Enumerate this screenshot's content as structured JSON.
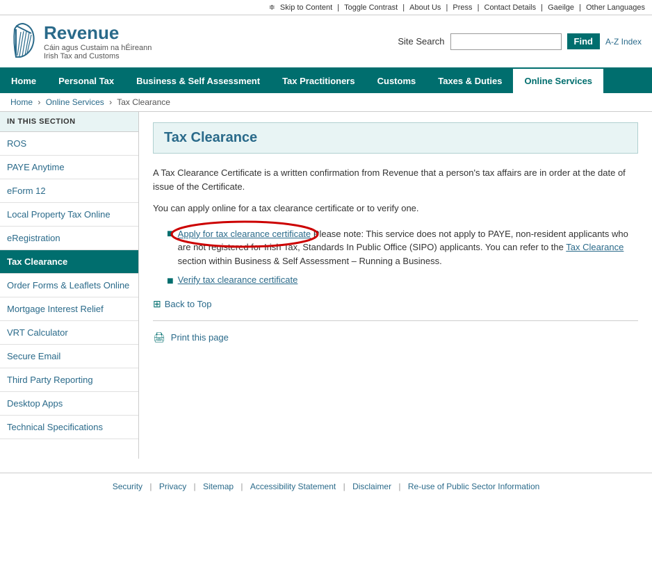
{
  "topbar": {
    "skip": "Skip to Content",
    "contrast": "Toggle Contrast",
    "about": "About Us",
    "press": "Press",
    "contact": "Contact Details",
    "gaeilge": "Gaeilge",
    "languages": "Other Languages"
  },
  "header": {
    "logo_line1": "Revenue",
    "logo_line2": "Cáin agus Custaim na hÉireann",
    "logo_line3": "Irish Tax and Customs",
    "search_label": "Site Search",
    "search_placeholder": "",
    "find_btn": "Find",
    "az": "A-Z Index"
  },
  "nav": {
    "items": [
      {
        "label": "Home",
        "active": false
      },
      {
        "label": "Personal Tax",
        "active": false
      },
      {
        "label": "Business & Self Assessment",
        "active": false
      },
      {
        "label": "Tax Practitioners",
        "active": false
      },
      {
        "label": "Customs",
        "active": false
      },
      {
        "label": "Taxes & Duties",
        "active": false
      },
      {
        "label": "Online Services",
        "active": true
      }
    ]
  },
  "breadcrumb": {
    "home": "Home",
    "online_services": "Online Services",
    "current": "Tax Clearance"
  },
  "sidebar": {
    "section_header": "IN THIS SECTION",
    "items": [
      {
        "label": "ROS",
        "active": false
      },
      {
        "label": "PAYE Anytime",
        "active": false
      },
      {
        "label": "eForm 12",
        "active": false
      },
      {
        "label": "Local Property Tax Online",
        "active": false
      },
      {
        "label": "eRegistration",
        "active": false
      },
      {
        "label": "Tax Clearance",
        "active": true
      },
      {
        "label": "Order Forms & Leaflets Online",
        "active": false
      },
      {
        "label": "Mortgage Interest Relief",
        "active": false
      },
      {
        "label": "VRT Calculator",
        "active": false
      },
      {
        "label": "Secure Email",
        "active": false
      },
      {
        "label": "Third Party Reporting",
        "active": false
      },
      {
        "label": "Desktop Apps",
        "active": false
      },
      {
        "label": "Technical Specifications",
        "active": false
      }
    ]
  },
  "content": {
    "page_title": "Tax Clearance",
    "para1": "A Tax Clearance Certificate is a written confirmation from Revenue that a person's tax affairs are in order at the date of issue of the Certificate.",
    "para2": "You can apply online for a tax clearance certificate or to verify one.",
    "link1_text": "Apply for tax clearance certificate",
    "link1_note": " Please note: This service does not apply to PAYE, non-resident applicants who are not registered for Irish Tax, Standards In Public Office (SIPO) applicants. You can refer to the ",
    "link1_note2": "Tax Clearance",
    "link1_note3": " section within Business & Self Assessment – Running a Business.",
    "link2_text": "Verify tax clearance certificate",
    "back_to_top": "Back to Top",
    "print_page": "Print this page"
  },
  "footer": {
    "links": [
      "Security",
      "Privacy",
      "Sitemap",
      "Accessibility Statement",
      "Disclaimer",
      "Re-use of Public Sector Information"
    ]
  }
}
